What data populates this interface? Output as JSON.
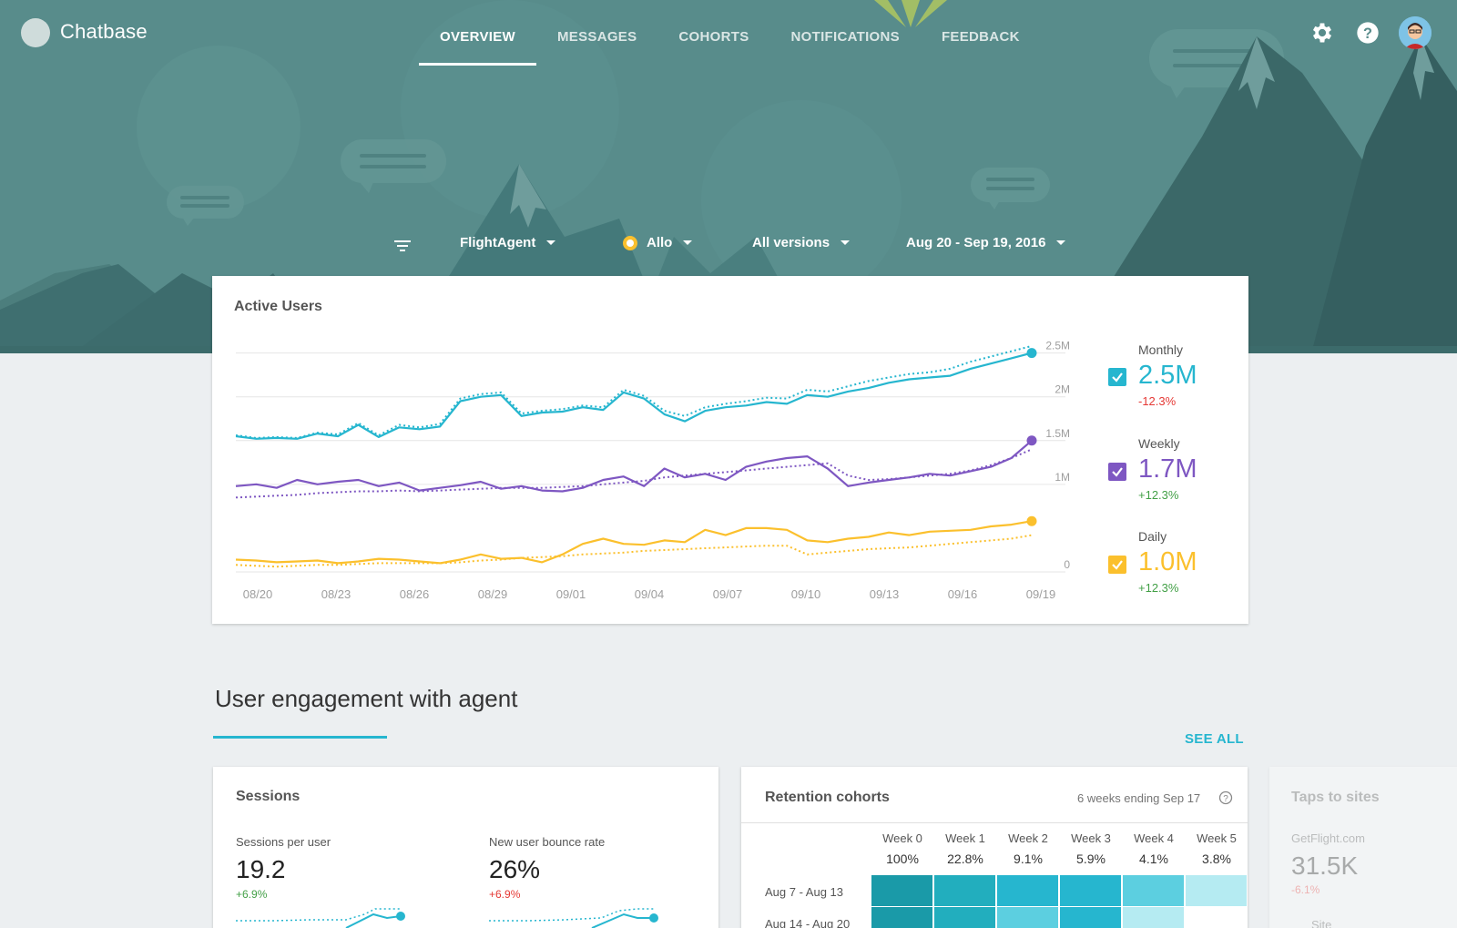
{
  "app": {
    "name": "Chatbase"
  },
  "nav": {
    "tabs": [
      "OVERVIEW",
      "MESSAGES",
      "COHORTS",
      "NOTIFICATIONS",
      "FEEDBACK"
    ],
    "active": 0
  },
  "filters": {
    "agent": "FlightAgent",
    "platform": "Allo",
    "version": "All versions",
    "date_range": "Aug 20 - Sep 19, 2016"
  },
  "active_users": {
    "title": "Active Users",
    "legend": [
      {
        "label": "Monthly",
        "value": "2.5M",
        "change": "-12.3%",
        "color": "#26b6cf"
      },
      {
        "label": "Weekly",
        "value": "1.7M",
        "change": "+12.3%",
        "color": "#7e57c2"
      },
      {
        "label": "Daily",
        "value": "1.0M",
        "change": "+12.3%",
        "color": "#fbc02d"
      }
    ]
  },
  "chart_data": {
    "type": "line",
    "x": [
      "08/20",
      "08/23",
      "08/26",
      "08/29",
      "09/01",
      "09/04",
      "09/07",
      "09/10",
      "09/13",
      "09/16",
      "09/19"
    ],
    "y_ticks": [
      "0",
      "1M",
      "1.5M",
      "2M",
      "2.5M"
    ],
    "ylim": [
      0,
      2.6
    ],
    "series": [
      {
        "name": "Monthly",
        "color": "#26b6cf",
        "values": [
          1.55,
          1.52,
          1.53,
          1.52,
          1.58,
          1.55,
          1.68,
          1.54,
          1.65,
          1.63,
          1.66,
          1.95,
          2.0,
          2.02,
          1.78,
          1.82,
          1.83,
          1.88,
          1.85,
          2.05,
          1.98,
          1.8,
          1.72,
          1.84,
          1.88,
          1.9,
          1.94,
          1.92,
          2.02,
          2.0,
          2.06,
          2.1,
          2.16,
          2.2,
          2.22,
          2.24,
          2.32,
          2.38,
          2.44,
          2.5
        ],
        "dotted": [
          1.56,
          1.53,
          1.54,
          1.53,
          1.59,
          1.57,
          1.7,
          1.56,
          1.68,
          1.65,
          1.69,
          1.98,
          2.03,
          2.05,
          1.81,
          1.84,
          1.86,
          1.9,
          1.88,
          2.08,
          2.01,
          1.84,
          1.78,
          1.88,
          1.92,
          1.95,
          1.99,
          1.98,
          2.08,
          2.06,
          2.12,
          2.18,
          2.22,
          2.26,
          2.28,
          2.32,
          2.4,
          2.46,
          2.52,
          2.58
        ]
      },
      {
        "name": "Weekly",
        "color": "#7e57c2",
        "values": [
          0.98,
          1.0,
          0.96,
          1.05,
          1.0,
          1.03,
          1.05,
          0.98,
          1.02,
          0.93,
          0.96,
          0.99,
          1.03,
          0.95,
          0.98,
          0.93,
          0.92,
          0.96,
          1.05,
          1.09,
          0.98,
          1.18,
          1.08,
          1.12,
          1.05,
          1.2,
          1.26,
          1.3,
          1.32,
          1.18,
          0.98,
          1.02,
          1.05,
          1.08,
          1.12,
          1.1,
          1.15,
          1.2,
          1.3,
          1.5
        ],
        "dotted": [
          0.85,
          0.86,
          0.87,
          0.88,
          0.9,
          0.91,
          0.92,
          0.92,
          0.93,
          0.92,
          0.93,
          0.94,
          0.95,
          0.96,
          0.96,
          0.96,
          0.97,
          0.98,
          1.0,
          1.02,
          1.04,
          1.08,
          1.1,
          1.12,
          1.14,
          1.16,
          1.18,
          1.2,
          1.22,
          1.24,
          1.1,
          1.05,
          1.06,
          1.08,
          1.1,
          1.12,
          1.16,
          1.22,
          1.3,
          1.4
        ]
      },
      {
        "name": "Daily",
        "color": "#fbc02d",
        "values": [
          0.14,
          0.13,
          0.11,
          0.12,
          0.13,
          0.1,
          0.12,
          0.15,
          0.14,
          0.12,
          0.1,
          0.14,
          0.2,
          0.15,
          0.16,
          0.11,
          0.2,
          0.32,
          0.38,
          0.32,
          0.31,
          0.36,
          0.34,
          0.48,
          0.42,
          0.5,
          0.5,
          0.48,
          0.36,
          0.34,
          0.38,
          0.4,
          0.45,
          0.42,
          0.46,
          0.47,
          0.48,
          0.52,
          0.54,
          0.58
        ],
        "dotted": [
          0.08,
          0.07,
          0.06,
          0.07,
          0.08,
          0.08,
          0.09,
          0.1,
          0.1,
          0.1,
          0.1,
          0.11,
          0.13,
          0.14,
          0.16,
          0.17,
          0.18,
          0.2,
          0.21,
          0.22,
          0.24,
          0.25,
          0.26,
          0.27,
          0.28,
          0.29,
          0.3,
          0.3,
          0.2,
          0.22,
          0.24,
          0.26,
          0.27,
          0.28,
          0.3,
          0.32,
          0.34,
          0.36,
          0.38,
          0.42
        ]
      }
    ]
  },
  "engagement": {
    "title": "User engagement with agent",
    "see_all": "SEE ALL"
  },
  "sessions": {
    "title": "Sessions",
    "metrics": [
      {
        "label": "Sessions per user",
        "value": "19.2",
        "change": "+6.9%",
        "change_color": "#43a047"
      },
      {
        "label": "New user bounce rate",
        "value": "26%",
        "change": "+6.9%",
        "change_color": "#e53935"
      }
    ]
  },
  "retention": {
    "title": "Retention cohorts",
    "subtitle": "6 weeks ending Sep 17",
    "weeks": [
      "Week 0",
      "Week 1",
      "Week 2",
      "Week 3",
      "Week 4",
      "Week 5"
    ],
    "percents": [
      "100%",
      "22.8%",
      "9.1%",
      "5.9%",
      "4.1%",
      "3.8%"
    ],
    "rows": [
      {
        "label": "Aug 7 - Aug 13",
        "shades": [
          "#1a9aa8",
          "#22aebe",
          "#26b6cf",
          "#26b6cf",
          "#5ccfe0",
          "#b5ebf2"
        ]
      },
      {
        "label": "Aug 14 - Aug 20",
        "shades": [
          "#1a9aa8",
          "#22aebe",
          "#5ccfe0",
          "#26b6cf",
          "#b5ebf2",
          "#ffffff"
        ]
      }
    ]
  },
  "taps": {
    "title": "Taps to sites",
    "site": "GetFlight.com",
    "value": "31.5K",
    "change": "-6.1%",
    "footer": "Site"
  }
}
